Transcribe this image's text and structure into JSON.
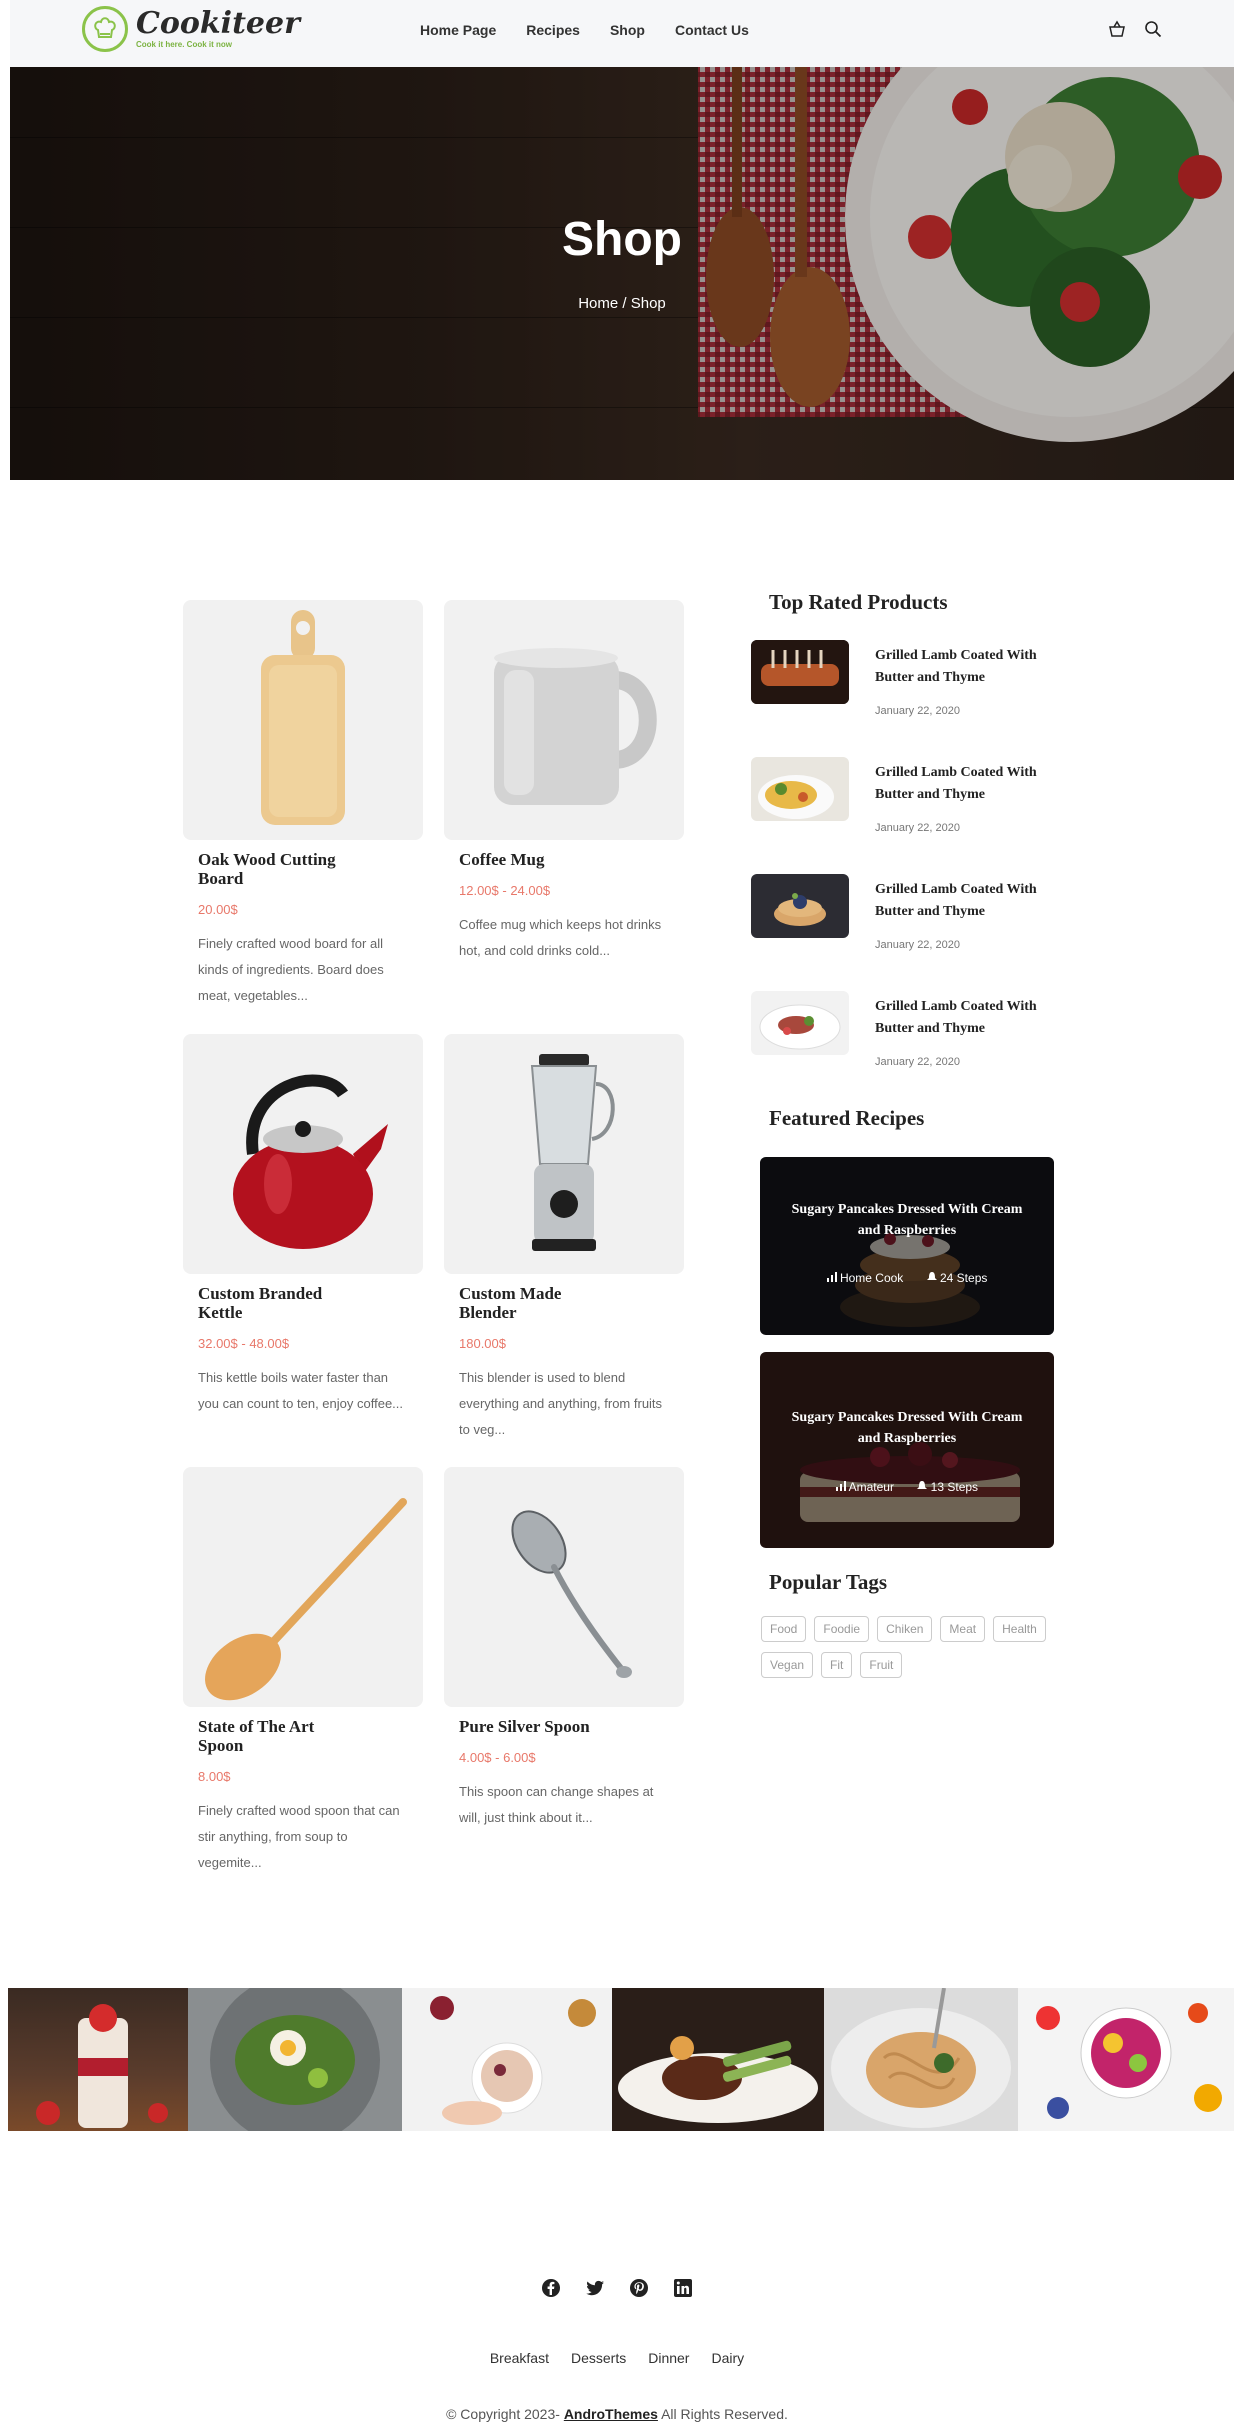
{
  "brand": {
    "name": "Cookiteer",
    "tagline": "Cook it here. Cook it now",
    "accent": "#8bc34a"
  },
  "nav": {
    "items": [
      "Home Page",
      "Recipes",
      "Shop",
      "Contact Us"
    ],
    "icons": [
      "basket-icon",
      "search-icon"
    ]
  },
  "hero": {
    "title": "Shop",
    "breadcrumb": "Home / Shop"
  },
  "products": [
    {
      "name": "Oak Wood Cutting Board",
      "price": "20.00$",
      "desc": "Finely crafted wood board for all kinds of ingredients. Board does meat, vegetables..."
    },
    {
      "name": "Coffee Mug",
      "price": "12.00$ - 24.00$",
      "desc": "Coffee mug which keeps hot drinks hot, and cold drinks cold..."
    },
    {
      "name": "Custom Branded Kettle",
      "price": "32.00$ - 48.00$",
      "desc": "This kettle boils water faster than you can count to ten, enjoy coffee..."
    },
    {
      "name": "Custom Made Blender",
      "price": "180.00$",
      "desc": "This blender is used to blend everything and anything, from fruits to veg..."
    },
    {
      "name": "State of The Art Spoon",
      "price": "8.00$",
      "desc": "Finely crafted wood spoon that can stir anything, from soup to vegemite..."
    },
    {
      "name": "Pure Silver Spoon",
      "price": "4.00$ - 6.00$",
      "desc": "This spoon can change shapes at will, just think about it..."
    }
  ],
  "price_color": "#e8786a",
  "sidebar": {
    "top_rated_heading": "Top Rated Products",
    "top_rated": [
      {
        "title": "Grilled Lamb Coated With Butter and Thyme",
        "date": "January 22, 2020"
      },
      {
        "title": "Grilled Lamb Coated With Butter and Thyme",
        "date": "January 22, 2020"
      },
      {
        "title": "Grilled Lamb Coated With Butter and Thyme",
        "date": "January 22, 2020"
      },
      {
        "title": "Grilled Lamb Coated With Butter and Thyme",
        "date": "January 22, 2020"
      }
    ],
    "featured_heading": "Featured Recipes",
    "featured": [
      {
        "title": "Sugary Pancakes Dressed With Cream and Raspberries",
        "level": "Home Cook",
        "steps": "24 Steps"
      },
      {
        "title": "Sugary Pancakes Dressed With Cream and Raspberries",
        "level": "Amateur",
        "steps": "13 Steps"
      }
    ],
    "tags_heading": "Popular Tags",
    "tags": [
      "Food",
      "Foodie",
      "Chiken",
      "Meat",
      "Health",
      "Vegan",
      "Fit",
      "Fruit"
    ]
  },
  "footer": {
    "social_icons": [
      "facebook-icon",
      "twitter-icon",
      "pinterest-icon",
      "linkedin-icon"
    ],
    "links": [
      "Breakfast",
      "Desserts",
      "Dinner",
      "Dairy"
    ],
    "copyright_prefix": "© Copyright 2023-",
    "copyright_brand": "AndroThemes",
    "copyright_suffix": "All Rights Reserved."
  }
}
